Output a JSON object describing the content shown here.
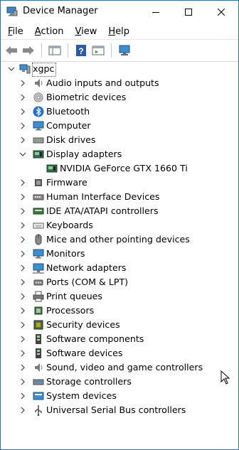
{
  "window": {
    "title": "Device Manager"
  },
  "menu": [
    {
      "pre": "",
      "u": "F",
      "post": "ile"
    },
    {
      "pre": "",
      "u": "A",
      "post": "ction"
    },
    {
      "pre": "",
      "u": "V",
      "post": "iew"
    },
    {
      "pre": "",
      "u": "H",
      "post": "elp"
    }
  ],
  "tree": {
    "root": "xgpc",
    "categories": [
      {
        "label": "Audio inputs and outputs",
        "icon": "speaker-icon"
      },
      {
        "label": "Biometric devices",
        "icon": "fingerprint-icon"
      },
      {
        "label": "Bluetooth",
        "icon": "bluetooth-icon"
      },
      {
        "label": "Computer",
        "icon": "computer-icon"
      },
      {
        "label": "Disk drives",
        "icon": "disk-drive-icon"
      },
      {
        "label": "Display adapters",
        "icon": "display-adapter-icon",
        "expanded": true,
        "children": [
          {
            "label": "NVIDIA GeForce GTX 1660 Ti",
            "icon": "display-adapter-icon"
          }
        ]
      },
      {
        "label": "Firmware",
        "icon": "firmware-icon"
      },
      {
        "label": "Human Interface Devices",
        "icon": "hid-icon"
      },
      {
        "label": "IDE ATA/ATAPI controllers",
        "icon": "ide-controller-icon"
      },
      {
        "label": "Keyboards",
        "icon": "keyboard-icon"
      },
      {
        "label": "Mice and other pointing devices",
        "icon": "mouse-icon"
      },
      {
        "label": "Monitors",
        "icon": "monitor-icon"
      },
      {
        "label": "Network adapters",
        "icon": "network-adapter-icon"
      },
      {
        "label": "Ports (COM & LPT)",
        "icon": "port-icon"
      },
      {
        "label": "Print queues",
        "icon": "printer-icon"
      },
      {
        "label": "Processors",
        "icon": "processor-icon"
      },
      {
        "label": "Security devices",
        "icon": "security-device-icon"
      },
      {
        "label": "Software components",
        "icon": "software-component-icon"
      },
      {
        "label": "Software devices",
        "icon": "software-device-icon"
      },
      {
        "label": "Sound, video and game controllers",
        "icon": "speaker-icon"
      },
      {
        "label": "Storage controllers",
        "icon": "storage-controller-icon"
      },
      {
        "label": "System devices",
        "icon": "system-device-icon"
      },
      {
        "label": "Universal Serial Bus controllers",
        "icon": "usb-icon"
      }
    ]
  }
}
